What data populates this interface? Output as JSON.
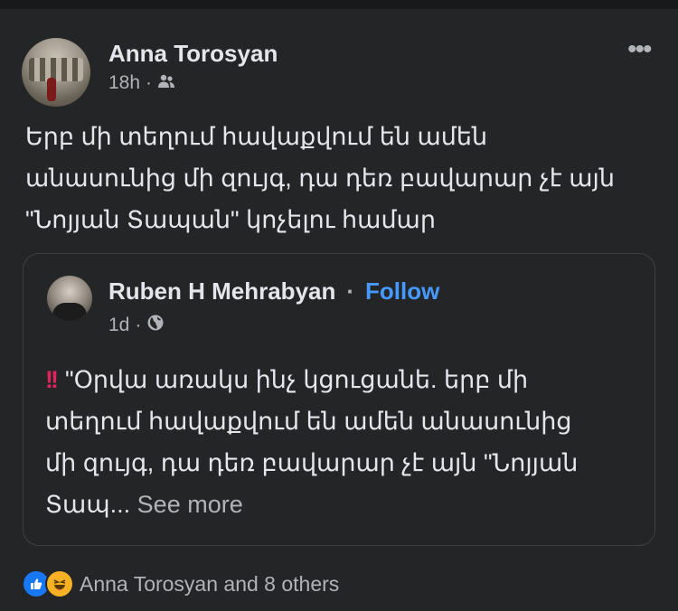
{
  "post": {
    "author": "Anna Torosyan",
    "time": "18h",
    "separator": "·",
    "audience_icon": "friends-icon",
    "menu_icon": "more-options-icon",
    "menu_glyph": "•••",
    "text_lines": [
      "Երբ մի տեղում հավաքվում են ամեն",
      "անասունից մի զույգ, դա դեռ բավարար չէ այն",
      "\"Նոյյան Տապան\" կոչելու համար"
    ]
  },
  "shared_post": {
    "author": "Ruben H Mehrabyan",
    "separator": "·",
    "follow_label": "Follow",
    "time": "1d",
    "audience_icon": "globe-icon",
    "alert_glyph": "!!",
    "text_lines": [
      "\"Օրվա առակս ինչ կցուցանե. երբ մի",
      "տեղում հավաքվում են ամեն անասունից",
      "մի զույգ, դա դեռ բավարար չէ այն \"Նոյյան",
      "Տապ..."
    ],
    "see_more_label": "See more"
  },
  "reactions": {
    "icons": [
      "like-icon",
      "haha-icon"
    ],
    "summary": "Anna Torosyan and 8 others"
  },
  "colors": {
    "background": "#242526",
    "text": "#e4e6eb",
    "secondary": "#b0b3b8",
    "link": "#4599ff",
    "border": "#3e4042"
  }
}
